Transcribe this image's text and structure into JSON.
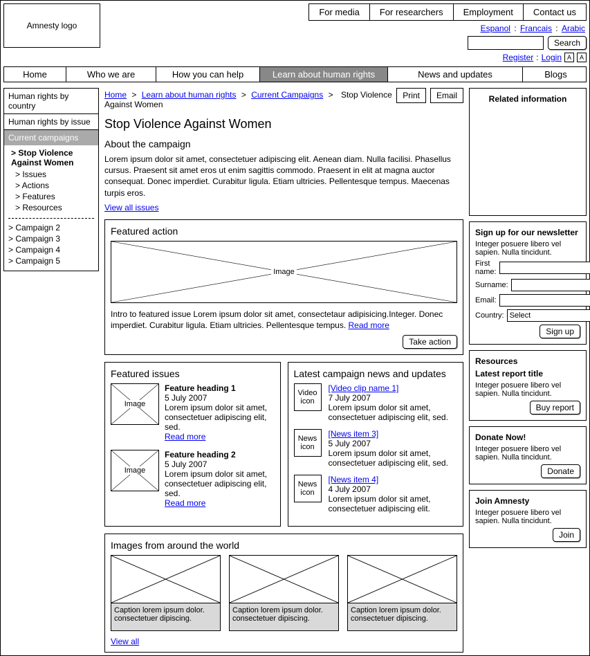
{
  "header": {
    "logo": "Amnesty logo",
    "top_links": [
      "For media",
      "For researchers",
      "Employment",
      "Contact us"
    ],
    "languages": [
      "Espanol",
      "Francais",
      "Arabic"
    ],
    "search_button": "Search",
    "register": "Register",
    "login": "Login",
    "font_small": "A",
    "font_large": "A"
  },
  "nav": {
    "home": "Home",
    "who": "Who we are",
    "help": "How you can help",
    "learn": "Learn about human rights",
    "news": "News and updates",
    "blogs": "Blogs"
  },
  "sidebar": {
    "country": "Human rights by country",
    "issue": "Human rights by issue",
    "current": "Current campaigns",
    "campaign_title": "Stop Violence Against Women",
    "sub": {
      "issues": "> Issues",
      "actions": "> Actions",
      "features": "> Features",
      "resources": "> Resources"
    },
    "others": [
      "> Campaign 2",
      "> Campaign 3",
      "> Campaign 4",
      "> Campaign 5"
    ]
  },
  "crumbs": {
    "home": "Home",
    "learn": "Learn about human rights",
    "current": "Current Campaigns",
    "page": "Stop Violence Against Women",
    "print": "Print",
    "email": "Email"
  },
  "page": {
    "title": "Stop Violence Against Women",
    "about_heading": "About the campaign",
    "about_text": "Lorem ipsum dolor sit amet, consectetuer adipiscing elit. Aenean diam. Nulla facilisi. Phasellus cursus. Praesent sit amet eros ut enim sagittis commodo. Praesent in elit at magna auctor consequat. Donec imperdiet. Curabitur ligula. Etiam ultricies. Pellentesque tempus. Maecenas turpis eros.",
    "view_all_issues": "View all issues"
  },
  "featured_action": {
    "heading": "Featured action",
    "image_label": "Image",
    "intro": "Intro to featured issue Lorem ipsum dolor sit amet, consectetaur adipisicing.Integer. Donec imperdiet. Curabitur ligula. Etiam ultricies. Pellentesque tempus. ",
    "read_more": "Read more",
    "button": "Take action"
  },
  "featured_issues": {
    "heading": "Featured issues",
    "items": [
      {
        "img": "Image",
        "title": "Feature heading 1",
        "date": "5 July 2007",
        "text": "Lorem ipsum dolor sit amet, consectetuer adipiscing elit, sed.",
        "link": "Read more"
      },
      {
        "img": "Image",
        "title": "Feature heading 2",
        "date": "5 July 2007",
        "text": "Lorem ipsum dolor sit amet, consectetuer adipiscing elit, sed.",
        "link": "Read more"
      }
    ]
  },
  "latest_news": {
    "heading": "Latest campaign news and updates",
    "items": [
      {
        "icon": "Video icon",
        "link": "[Video clip name 1]",
        "date": "7 July 2007",
        "text": "Lorem ipsum dolor sit amet, consectetuer adipiscing elit, sed."
      },
      {
        "icon": "News icon",
        "link": "[News item 3]",
        "date": "5 July 2007",
        "text": "Lorem ipsum dolor sit amet, consectetuer adipiscing elit, sed."
      },
      {
        "icon": "News icon",
        "link": "[News item 4]",
        "date": "4 July 2007",
        "text": "Lorem ipsum dolor sit amet, consectetuer adipiscing elit."
      }
    ]
  },
  "gallery": {
    "heading": "Images from around the world",
    "captions": [
      "Caption lorem ipsum dolor. consectetuer dipiscing.",
      "Caption lorem ipsum dolor. consectetuer dipiscing.",
      "Caption lorem ipsum dolor. consectetuer dipiscing."
    ],
    "view_all": "View all"
  },
  "aside": {
    "related": "Related information",
    "newsletter": {
      "heading": "Sign up for our  newsletter",
      "intro": "Integer posuere libero vel sapien. Nulla tincidunt.",
      "first_name": "First name:",
      "surname": "Surname:",
      "email": "Email:",
      "country": "Country:",
      "country_value": "Select",
      "button": "Sign up"
    },
    "resources": {
      "heading": "Resources",
      "title": "Latest report title",
      "text": "Integer posuere libero vel sapien. Nulla tincidunt.",
      "button": "Buy report"
    },
    "donate": {
      "heading": "Donate Now!",
      "text": "Integer posuere libero vel sapien. Nulla tincidunt.",
      "button": "Donate"
    },
    "join": {
      "heading": "Join Amnesty",
      "text": "Integer posuere libero vel sapien. Nulla tincidunt.",
      "button": "Join"
    }
  }
}
